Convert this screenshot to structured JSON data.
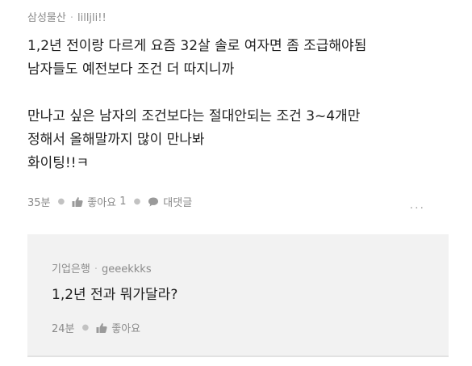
{
  "post": {
    "company": "삼성물산",
    "username": "lilljli!!",
    "lines": [
      "1,2년 전이랑 다르게 요즘 32살 솔로 여자면 좀 조급해야됨",
      "남자들도 예전보다 조건 더 따지니까",
      "",
      "만나고 싶은 남자의 조건보다는 절대안되는 조건 3~4개만",
      "정해서 올해말까지 많이 만나봐",
      "화이팅!!ㅋ"
    ],
    "time": "35분",
    "like_label": "좋아요",
    "like_count": "1",
    "comment_label": "대댓글",
    "more_label": "···"
  },
  "reply": {
    "company": "기업은행",
    "username": "geeekkks",
    "text": "1,2년 전과 뭐가달라?",
    "time": "24분",
    "like_label": "좋아요"
  },
  "icons": {
    "like": "thumbs-up-icon",
    "comment": "speech-bubble-icon",
    "more": "ellipsis-icon"
  },
  "colors": {
    "text": "#202020",
    "meta": "#8a8a8a",
    "reply_bg": "#f2f2f2"
  }
}
